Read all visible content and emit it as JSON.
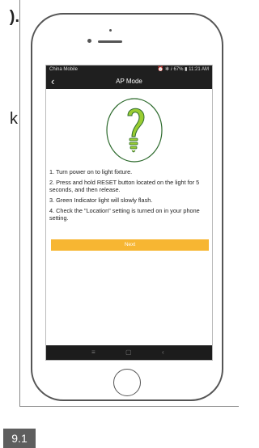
{
  "page": {
    "edge_text_top": ").",
    "edge_text_mid": "k",
    "figure_label": "9.1"
  },
  "statusbar": {
    "carrier": "China Mobile",
    "right": "⏰ ✻ ⅈ 67% ▮ 11:21 AM"
  },
  "navbar": {
    "title": "AP Mode",
    "back_icon": "chevron-left"
  },
  "instructions": [
    "1. Turn power on to light fixture.",
    "2. Press and hold RESET button located on the light for 5 seconds, and then release.",
    "3. Green Indicator light will slowly flash.",
    "4. Check the \"Location\" setting is turned on in your phone setting."
  ],
  "buttons": {
    "next": "Next"
  },
  "system_nav": {
    "recent_icon": "recent-apps",
    "home_icon": "home",
    "back_icon": "back"
  },
  "colors": {
    "accent": "#f7b632",
    "bulb_green": "#9acd32",
    "bulb_outline": "#2e6b2e",
    "bars": "#1f1f1f"
  }
}
